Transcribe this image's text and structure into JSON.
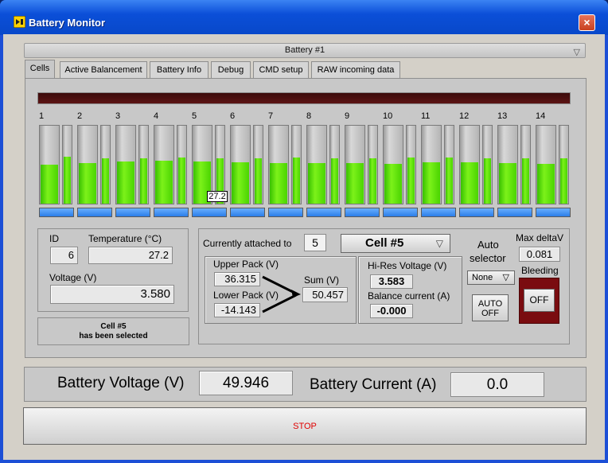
{
  "window": {
    "title": "Battery Monitor",
    "close": "×"
  },
  "battery_select": {
    "value": "Battery #1"
  },
  "tabs": [
    {
      "label": "Cells"
    },
    {
      "label": "Active Balancement"
    },
    {
      "label": "Battery Info"
    },
    {
      "label": "Debug"
    },
    {
      "label": "CMD setup"
    },
    {
      "label": "RAW incoming data"
    }
  ],
  "cells": {
    "numbers": [
      "1",
      "2",
      "3",
      "4",
      "5",
      "6",
      "7",
      "8",
      "9",
      "10",
      "11",
      "12",
      "13",
      "14"
    ],
    "levels_a": [
      0.5,
      0.52,
      0.54,
      0.55,
      0.54,
      0.53,
      0.52,
      0.52,
      0.52,
      0.51,
      0.53,
      0.53,
      0.52,
      0.51
    ],
    "levels_b": [
      0.6,
      0.58,
      0.58,
      0.59,
      0.58,
      0.58,
      0.59,
      0.58,
      0.58,
      0.59,
      0.59,
      0.58,
      0.58,
      0.58
    ],
    "tooltip": "27.2"
  },
  "detail": {
    "id_label": "ID",
    "id_value": "6",
    "temp_label": "Temperature (°C)",
    "temp_value": "27.2",
    "voltage_label": "Voltage (V)",
    "voltage_value": "3.580",
    "status_line1": "Cell #5",
    "status_line2": "has been selected"
  },
  "attach": {
    "attached_label": "Currently attached to",
    "attached_value": "5",
    "cell_select": "Cell #5",
    "upper_label": "Upper Pack (V)",
    "upper_value": "36.315",
    "lower_label": "Lower Pack (V)",
    "lower_value": "-14.143",
    "sum_label": "Sum (V)",
    "sum_value": "50.457",
    "hires_label": "Hi-Res Voltage (V)",
    "hires_value": "3.583",
    "balance_label": "Balance current (A)",
    "balance_value": "-0.000",
    "auto_label1": "Auto",
    "auto_label2": "selector",
    "auto_value": "None",
    "auto_off_line1": "AUTO",
    "auto_off_line2": "OFF",
    "max_delta_label": "Max deltaV",
    "max_delta_value": "0.081",
    "bleeding_label": "Bleeding",
    "bleeding_button": "OFF"
  },
  "totals": {
    "voltage_label": "Battery Voltage (V)",
    "voltage_value": "49.946",
    "current_label": "Battery Current (A)",
    "current_value": "0.0"
  },
  "stop": {
    "label": "STOP"
  },
  "colors": {
    "fill": "#5ee20c",
    "bar": "#3f8ff0",
    "stop_text": "#e00000",
    "bleed_led": "#7a0c10"
  }
}
